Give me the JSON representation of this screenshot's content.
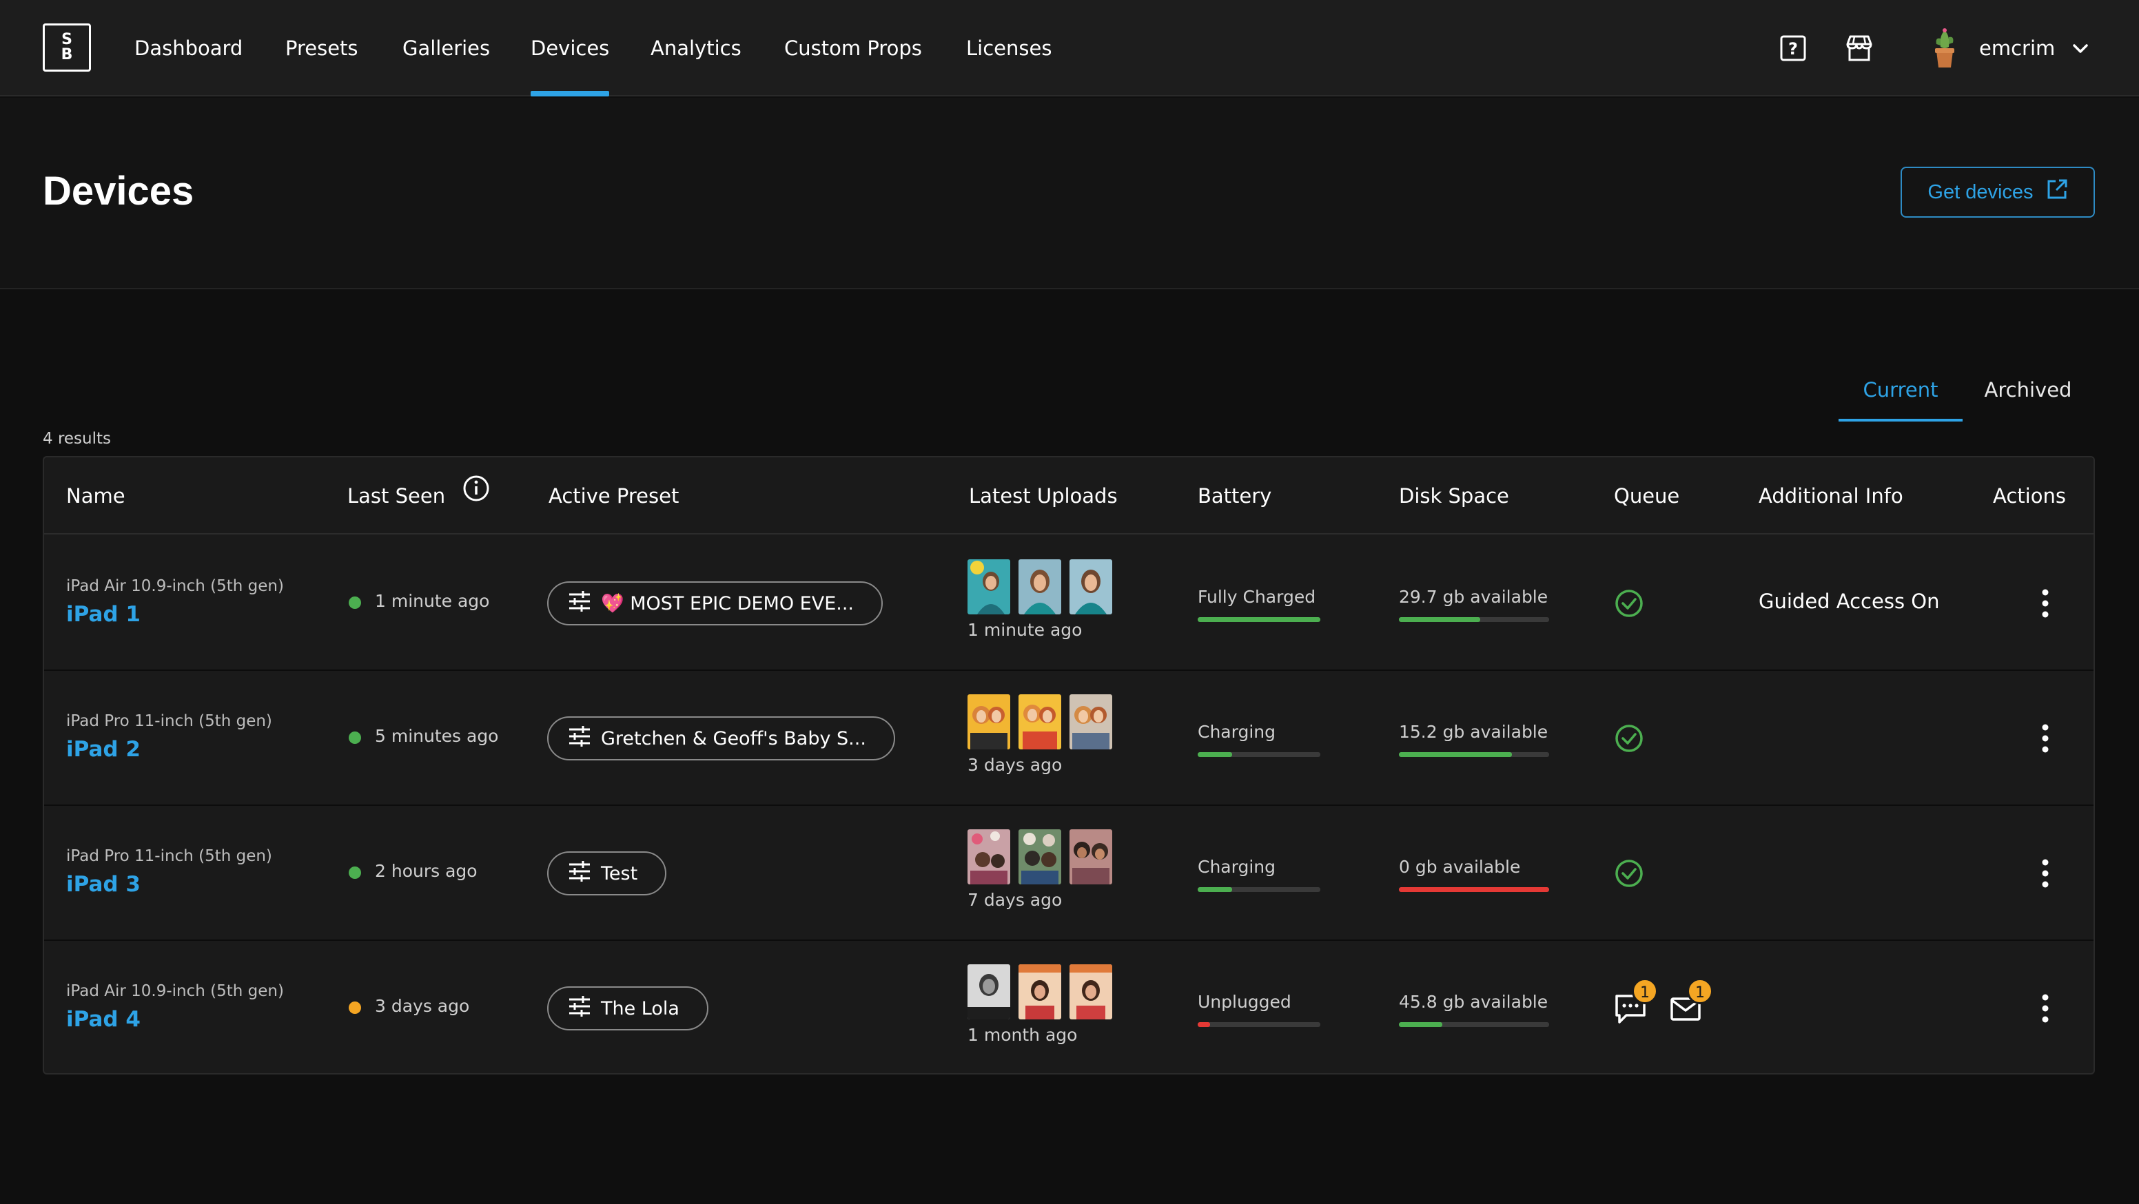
{
  "nav": {
    "logo_top": "S",
    "logo_bottom": "B",
    "items": [
      {
        "label": "Dashboard"
      },
      {
        "label": "Presets"
      },
      {
        "label": "Galleries"
      },
      {
        "label": "Devices",
        "active": true
      },
      {
        "label": "Analytics"
      },
      {
        "label": "Custom Props"
      },
      {
        "label": "Licenses"
      }
    ],
    "help_icon": "help-box-icon",
    "store_icon": "storefront-icon",
    "username": "emcrim"
  },
  "header": {
    "title": "Devices",
    "get_devices_label": "Get devices",
    "get_devices_icon": "external-link-icon"
  },
  "tabs": [
    {
      "label": "Current",
      "active": true
    },
    {
      "label": "Archived",
      "active": false
    }
  ],
  "results_count": "4 results",
  "table": {
    "columns": [
      "Name",
      "Last Seen",
      "Active Preset",
      "Latest Uploads",
      "Battery",
      "Disk Space",
      "Queue",
      "Additional Info",
      "Actions"
    ],
    "rows": [
      {
        "model": "iPad Air 10.9-inch (5th gen)",
        "name": "iPad 1",
        "last_seen": "1 minute ago",
        "status_color": "#4caf50",
        "preset": "💖 MOST EPIC DEMO EVE...",
        "upload_time": "1 minute ago",
        "battery": "Fully Charged",
        "battery_level": 1.0,
        "battery_color": "#4caf50",
        "disk": "29.7 gb available",
        "disk_level": 0.54,
        "disk_color": "#4caf50",
        "queue": "ok",
        "additional_info": "Guided Access On"
      },
      {
        "model": "iPad Pro 11-inch (5th gen)",
        "name": "iPad 2",
        "last_seen": "5 minutes ago",
        "status_color": "#4caf50",
        "preset": "Gretchen & Geoff's Baby S...",
        "upload_time": "3 days ago",
        "battery": "Charging",
        "battery_level": 0.28,
        "battery_color": "#4caf50",
        "disk": "15.2 gb available",
        "disk_level": 0.75,
        "disk_color": "#4caf50",
        "queue": "ok",
        "additional_info": ""
      },
      {
        "model": "iPad Pro 11-inch (5th gen)",
        "name": "iPad 3",
        "last_seen": "2 hours ago",
        "status_color": "#4caf50",
        "preset": "Test",
        "upload_time": "7 days ago",
        "battery": "Charging",
        "battery_level": 0.28,
        "battery_color": "#4caf50",
        "disk": "0 gb available",
        "disk_level": 1.0,
        "disk_color": "#e53935",
        "queue": "ok",
        "additional_info": ""
      },
      {
        "model": "iPad Air 10.9-inch (5th gen)",
        "name": "iPad 4",
        "last_seen": "3 days ago",
        "status_color": "#f5a623",
        "preset": "The Lola",
        "upload_time": "1 month ago",
        "battery": "Unplugged",
        "battery_level": 0.1,
        "battery_color": "#e53935",
        "disk": "45.8 gb available",
        "disk_level": 0.29,
        "disk_color": "#4caf50",
        "queue": "pending",
        "queue_messages": "1",
        "queue_emails": "1",
        "additional_info": ""
      }
    ]
  },
  "colors": {
    "accent": "#2ea3e6",
    "ok_green": "#4caf50",
    "warning": "#f5a623",
    "error": "#e53935"
  }
}
